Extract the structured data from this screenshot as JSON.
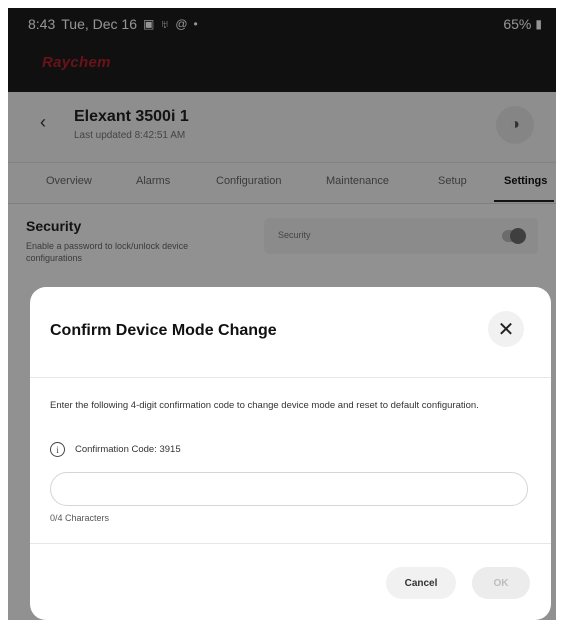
{
  "status_bar": {
    "time": "8:43",
    "date": "Tue, Dec 16",
    "icons": [
      "image-icon",
      "wifi-icon",
      "at-icon",
      "dot-icon"
    ],
    "battery": "65%"
  },
  "app": {
    "brand": "Raychem"
  },
  "device": {
    "title": "Elexant 3500i 1",
    "subtitle": "Last updated 8:42:51 AM"
  },
  "tabs": [
    {
      "label": "Overview"
    },
    {
      "label": "Alarms"
    },
    {
      "label": "Configuration"
    },
    {
      "label": "Maintenance"
    },
    {
      "label": "Setup"
    },
    {
      "label": "Settings",
      "active": true
    }
  ],
  "security": {
    "title": "Security",
    "description": "Enable a password to lock/unlock device configurations",
    "field_label": "Security",
    "enabled": false
  },
  "dialog": {
    "title": "Confirm Device Mode Change",
    "close_symbol": "✕",
    "body": "Enter the following 4-digit confirmation code to change device mode and reset to default configuration.",
    "info_symbol": "i",
    "confirmation_code": "Confirmation Code: 3915",
    "input_value": "",
    "input_placeholder": "",
    "char_count": "0/4 Characters",
    "cancel_label": "Cancel",
    "ok_label": "OK"
  },
  "colors": {
    "brand": "#b3202c",
    "header_bg": "#1c1c1c"
  }
}
